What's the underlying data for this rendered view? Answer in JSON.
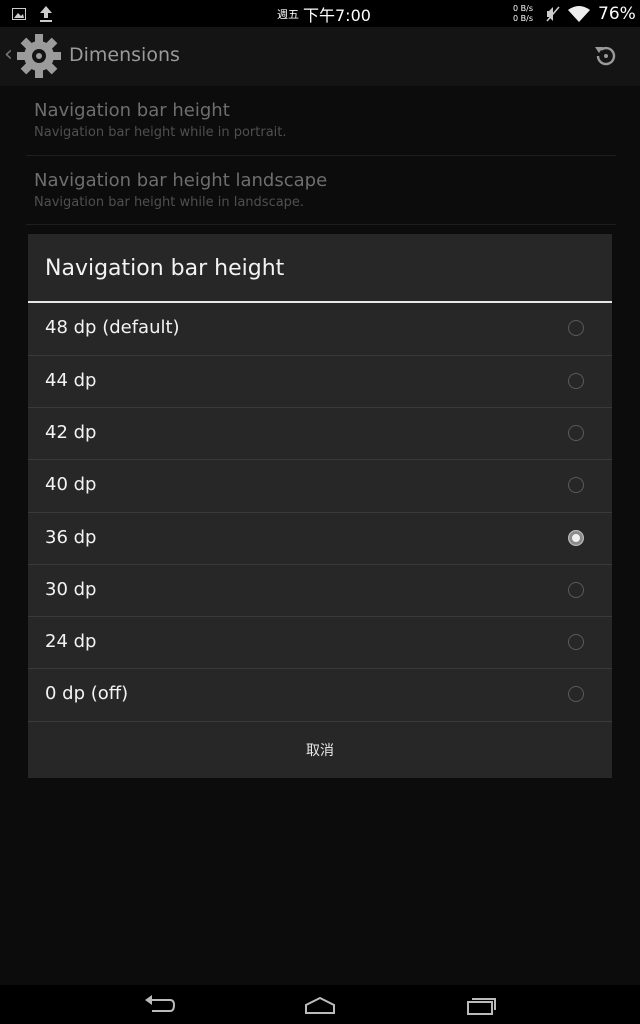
{
  "status_bar": {
    "day": "週五",
    "time": "下午7:00",
    "upload_speed": "0 B/s",
    "download_speed": "0 B/s",
    "battery": "76%",
    "icons": [
      "image-icon",
      "upload-icon",
      "mute-icon",
      "wifi-icon"
    ]
  },
  "action_bar": {
    "title": "Dimensions",
    "icons": [
      "gear-icon",
      "refresh-icon"
    ]
  },
  "preferences": [
    {
      "title": "Navigation bar height",
      "summary": "Navigation bar height while in portrait."
    },
    {
      "title": "Navigation bar height landscape",
      "summary": "Navigation bar height while in landscape."
    }
  ],
  "dialog": {
    "title": "Navigation bar height",
    "options": [
      {
        "label": "48 dp (default)",
        "checked": false
      },
      {
        "label": "44 dp",
        "checked": false
      },
      {
        "label": "42 dp",
        "checked": false
      },
      {
        "label": "40 dp",
        "checked": false
      },
      {
        "label": "36 dp",
        "checked": true
      },
      {
        "label": "30 dp",
        "checked": false
      },
      {
        "label": "24 dp",
        "checked": false
      },
      {
        "label": "0 dp (off)",
        "checked": false
      }
    ],
    "cancel_label": "取消"
  },
  "nav_bar": {
    "icons": [
      "back-icon",
      "home-icon",
      "recents-icon"
    ]
  },
  "colors": {
    "dialog_bg": "#272727",
    "accent_rule": "#e8e8e8",
    "screen_bg": "#0c0c0c"
  }
}
